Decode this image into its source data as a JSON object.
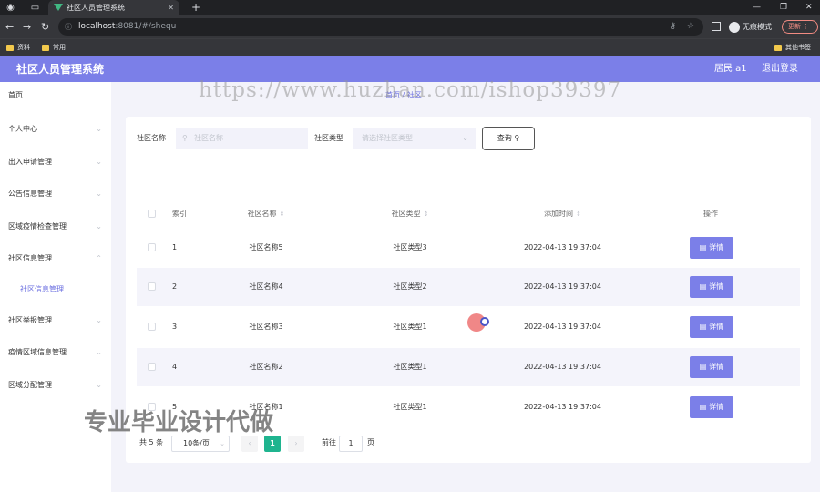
{
  "browser": {
    "tab_title": "社区人员管理系统",
    "url_host": "localhost",
    "url_rest": ":8081/#/shequ",
    "incognito_label": "无痕模式",
    "update_label": "更新",
    "bookmarks": [
      "资料",
      "常用"
    ],
    "other_bookmarks": "其他书签"
  },
  "app": {
    "title": "社区人员管理系统",
    "user": "居民 a1",
    "logout": "退出登录"
  },
  "sidebar": {
    "items": [
      {
        "label": "首页"
      },
      {
        "label": "个人中心"
      },
      {
        "label": "出入申请管理"
      },
      {
        "label": "公告信息管理"
      },
      {
        "label": "区域疫情检查管理"
      },
      {
        "label": "社区信息管理"
      },
      {
        "label": "社区信息管理"
      },
      {
        "label": "社区举报管理"
      },
      {
        "label": "疫情区域信息管理"
      },
      {
        "label": "区域分配管理"
      }
    ]
  },
  "breadcrumb": "首页 / 社区",
  "search": {
    "name_label": "社区名称",
    "name_placeholder": "社区名称",
    "type_label": "社区类型",
    "type_placeholder": "请选择社区类型",
    "query_button": "查询"
  },
  "table": {
    "headers": {
      "index": "索引",
      "name": "社区名称",
      "type": "社区类型",
      "time": "添加时间",
      "action": "操作"
    },
    "detail_label": "详情",
    "rows": [
      {
        "index": "1",
        "name": "社区名称5",
        "type": "社区类型3",
        "time": "2022-04-13 19:37:04"
      },
      {
        "index": "2",
        "name": "社区名称4",
        "type": "社区类型2",
        "time": "2022-04-13 19:37:04"
      },
      {
        "index": "3",
        "name": "社区名称3",
        "type": "社区类型1",
        "time": "2022-04-13 19:37:04"
      },
      {
        "index": "4",
        "name": "社区名称2",
        "type": "社区类型1",
        "time": "2022-04-13 19:37:04"
      },
      {
        "index": "5",
        "name": "社区名称1",
        "type": "社区类型1",
        "time": "2022-04-13 19:37:04"
      }
    ]
  },
  "pagination": {
    "total": "共 5 条",
    "page_size": "10条/页",
    "current_page": "1",
    "goto_label": "前往",
    "goto_value": "1",
    "page_suffix": "页"
  },
  "overlays": {
    "watermark": "https://www.huzhan.com/ishop39397",
    "promo": "专业毕业设计代做"
  },
  "colors": {
    "accent": "#7b7fe8",
    "active_page": "#1fb48f"
  }
}
